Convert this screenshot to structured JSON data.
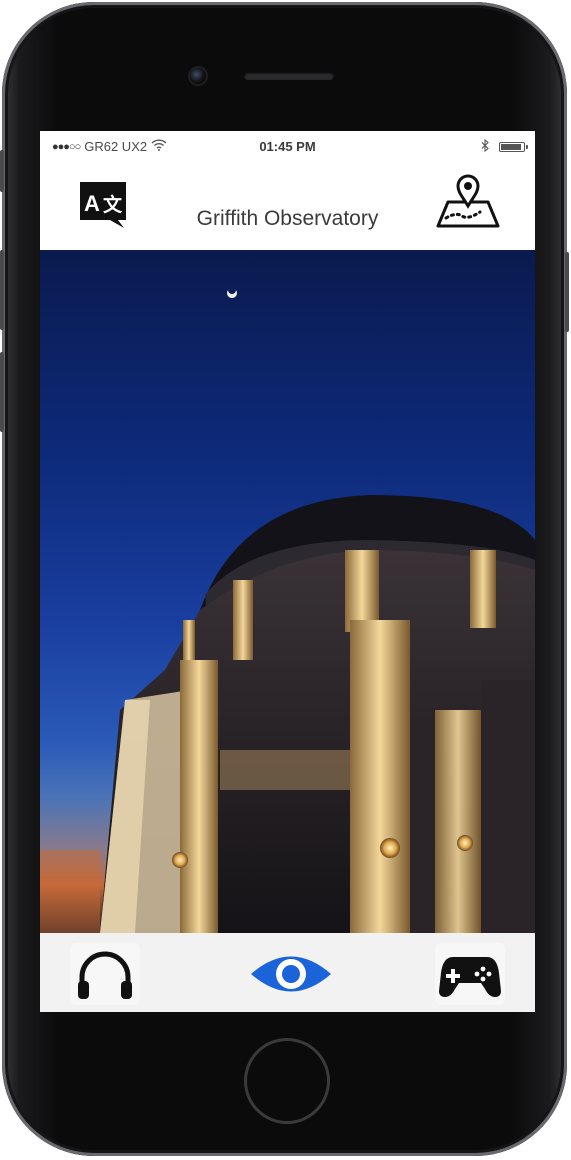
{
  "status_bar": {
    "signal_dots": "●●●○○",
    "carrier": "GR62 UX2",
    "time": "01:45 PM"
  },
  "nav": {
    "title": "Griffith Observatory",
    "left_icon": "translate-icon",
    "right_icon": "map-pin-icon"
  },
  "camera_button": {
    "icon": "camera-icon"
  },
  "tab_bar": {
    "tabs": [
      {
        "icon": "headphones-icon",
        "active": false
      },
      {
        "icon": "eye-icon",
        "active": true
      },
      {
        "icon": "gamepad-icon",
        "active": false
      }
    ]
  },
  "colors": {
    "active_tab": "#1a63d8",
    "icon_dark": "#111111",
    "sky_top": "#0a1a4e",
    "sky_mid": "#1a3fa0"
  }
}
